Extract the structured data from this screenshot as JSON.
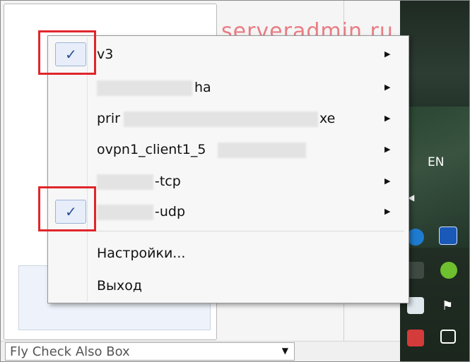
{
  "watermark": "serveradmin.ru",
  "menu": {
    "items": [
      {
        "label": "v3",
        "checked": true,
        "submenu": true
      },
      {
        "label": "ha",
        "checked": false,
        "submenu": true
      },
      {
        "label_start": "prir",
        "label_end": "xe",
        "checked": false,
        "submenu": true
      },
      {
        "label": "ovpn1_client1_5",
        "checked": false,
        "submenu": true
      },
      {
        "label": "-tcp",
        "checked": false,
        "submenu": true
      },
      {
        "label": "-udp",
        "checked": true,
        "submenu": true
      }
    ],
    "settings": "Настройки...",
    "exit": "Выход",
    "check_glyph": "✓",
    "arrow_glyph": "▶"
  },
  "combo": {
    "value": "Fly Check Also Box",
    "arrow": "▼"
  },
  "taskbar": {
    "language": "EN",
    "expand_arrow": "◀",
    "icons": [
      "teamviewer-icon",
      "lock-icon",
      "evernote-icon",
      "green-app-icon",
      "network-icon",
      "flag-icon",
      "power-icon",
      "monitor-icon"
    ]
  },
  "colors": {
    "highlight": "#e0262b",
    "watermark": "#e97c84",
    "check": "#2b4f91"
  }
}
